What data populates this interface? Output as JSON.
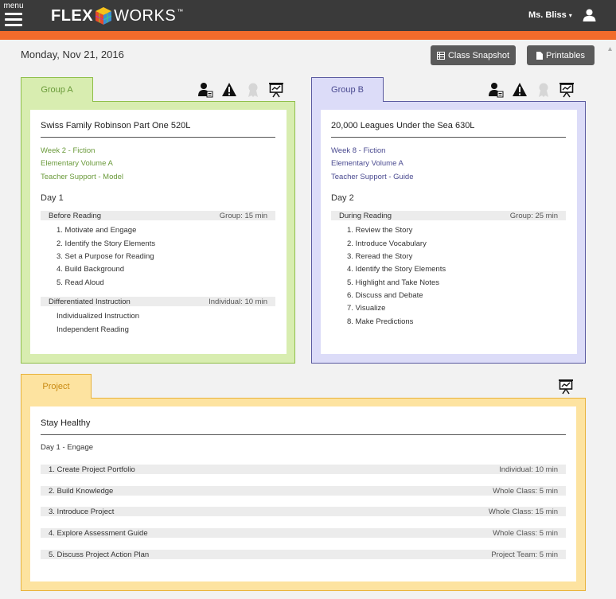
{
  "header": {
    "menu_label": "menu",
    "logo_left": "FLEX",
    "logo_right": "WORKS",
    "logo_tm": "™",
    "user_name": "Ms. Bliss",
    "user_caret": "▾"
  },
  "toolbar": {
    "date": "Monday, Nov 21, 2016",
    "class_snapshot_label": "Class Snapshot",
    "printables_label": "Printables"
  },
  "groups": [
    {
      "tab_label": "Group A",
      "title": "Swiss Family Robinson  Part One 520L",
      "week": "Week 2 - Fiction",
      "volume": "Elementary Volume A",
      "support": "Teacher Support - Model",
      "day": "Day 1",
      "sections": [
        {
          "name": "Before Reading",
          "time": "Group: 15 min",
          "items": [
            "1. Motivate and Engage",
            "2. Identify the Story Elements",
            "3. Set a Purpose for Reading",
            "4. Build Background",
            "5. Read Aloud"
          ]
        },
        {
          "name": "Differentiated Instruction",
          "time": "Individual: 10 min",
          "items": [
            "Individualized Instruction",
            "Independent Reading"
          ]
        }
      ]
    },
    {
      "tab_label": "Group B",
      "title": "20,000 Leagues Under the Sea 630L",
      "week": "Week 8 - Fiction",
      "volume": "Elementary Volume A",
      "support": "Teacher Support - Guide",
      "day": "Day 2",
      "sections": [
        {
          "name": "During Reading",
          "time": "Group: 25 min",
          "items": [
            "1. Review the Story",
            "2. Introduce Vocabulary",
            "3. Reread the Story",
            "4. Identify the Story Elements",
            "5. Highlight and Take Notes",
            "6. Discuss and Debate",
            "7. Visualize",
            "8. Make Predictions"
          ]
        }
      ]
    }
  ],
  "project": {
    "tab_label": "Project",
    "title": "Stay Healthy",
    "day": "Day 1 - Engage",
    "steps": [
      {
        "name": "1. Create Project Portfolio",
        "time": "Individual: 10 min"
      },
      {
        "name": "2. Build Knowledge",
        "time": "Whole Class: 5 min"
      },
      {
        "name": "3. Introduce Project",
        "time": "Whole Class: 15 min"
      },
      {
        "name": "4. Explore Assessment Guide",
        "time": "Whole Class: 5 min"
      },
      {
        "name": "5. Discuss Project Action Plan",
        "time": "Project Team: 5 min"
      }
    ]
  },
  "colors": {
    "header_bg": "#3a3a3a",
    "accent_orange": "#f26b2b",
    "group_a_bg": "#d8edb0",
    "group_b_bg": "#dcdcf8",
    "project_bg": "#fde3a0"
  }
}
